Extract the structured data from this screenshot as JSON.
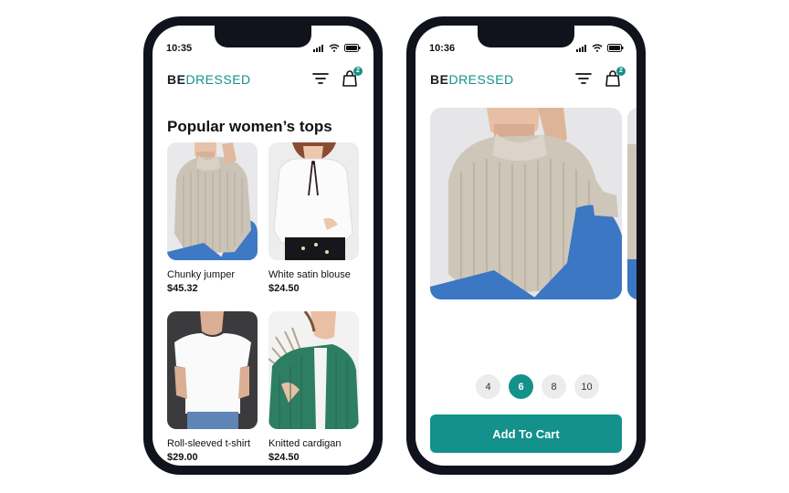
{
  "colors": {
    "accent": "#13918a",
    "frame": "#10121c",
    "chip": "#ececec"
  },
  "brand": {
    "part1": "BE",
    "part2": "DRESSED"
  },
  "phone1": {
    "time": "10:35",
    "cart_count": "2",
    "section_title": "Popular women’s tops",
    "products": [
      {
        "name": "Chunky jumper",
        "price": "$45.32",
        "image": "chunky-knit-sweater-photo"
      },
      {
        "name": "White satin blouse",
        "price": "$24.50",
        "image": "white-blouse-photo"
      },
      {
        "name": "Roll-sleeved t-shirt",
        "price": "$29.00",
        "image": "white-tshirt-photo"
      },
      {
        "name": "Knitted cardigan",
        "price": "$24.50",
        "image": "green-cardigan-photo"
      }
    ]
  },
  "phone2": {
    "time": "10:36",
    "cart_count": "2",
    "sizes": [
      "4",
      "6",
      "8",
      "10"
    ],
    "selected_size": "6",
    "add_to_cart_label": "Add To Cart"
  },
  "icons": [
    "signal-icon",
    "wifi-icon",
    "battery-icon",
    "filter-icon",
    "shopping-bag-icon"
  ]
}
